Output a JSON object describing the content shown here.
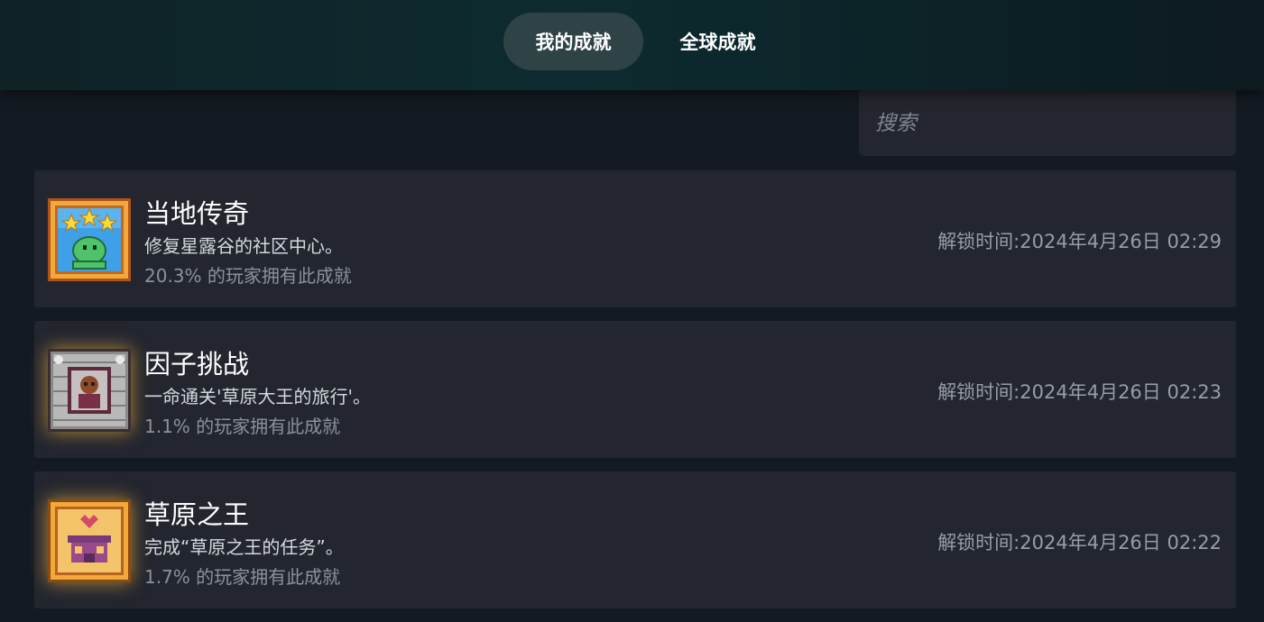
{
  "tabs": [
    {
      "label": "我的成就",
      "active": true
    },
    {
      "label": "全球成就",
      "active": false
    }
  ],
  "search": {
    "placeholder": "搜索",
    "value": ""
  },
  "achievements": [
    {
      "title": "当地传奇",
      "description": "修复星露谷的社区中心。",
      "percent_text": "20.3% 的玩家拥有此成就",
      "unlock_label": "解锁时间:",
      "unlock_time": "2024年4月26日 02:29",
      "icon": "stars-frog-icon"
    },
    {
      "title": "因子挑战",
      "description": "一命通关'草原大王的旅行'。",
      "percent_text": "1.1% 的玩家拥有此成就",
      "unlock_label": "解锁时间:",
      "unlock_time": "2024年4月26日 02:23",
      "icon": "skull-frame-icon"
    },
    {
      "title": "草原之王",
      "description": "完成“草原之王的任务”。",
      "percent_text": "1.7% 的玩家拥有此成就",
      "unlock_label": "解锁时间:",
      "unlock_time": "2024年4月26日 02:22",
      "icon": "prairie-king-icon"
    }
  ],
  "colors": {
    "background": "#141a22",
    "card": "#23262f",
    "active_tab": "#2f4347",
    "icon_gold": "#e7a33a"
  }
}
